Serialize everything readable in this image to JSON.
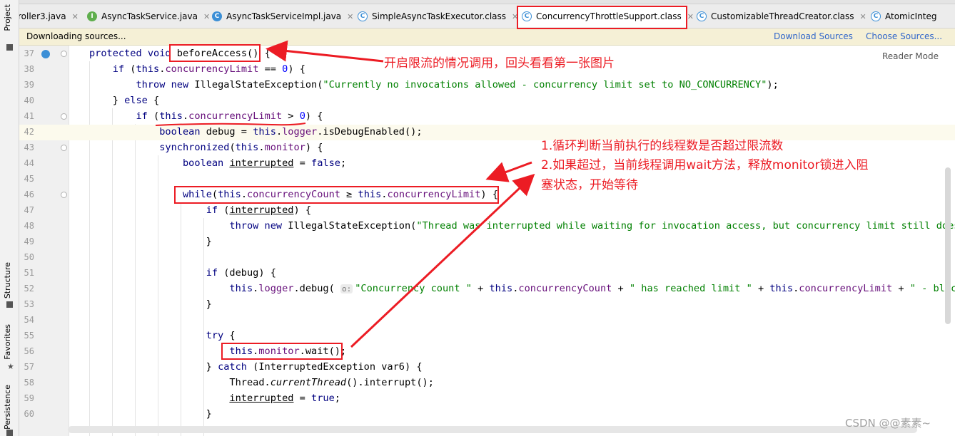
{
  "left_tools": {
    "project": "Project",
    "structure": "Structure",
    "favorites": "Favorites",
    "persistence": "Persistence"
  },
  "tabs": [
    {
      "label": "roller3.java",
      "icon": "class-icon"
    },
    {
      "label": "AsyncTaskService.java",
      "icon": "interface-icon"
    },
    {
      "label": "AsyncTaskServiceImpl.java",
      "icon": "class-icon"
    },
    {
      "label": "SimpleAsyncTaskExecutor.class",
      "icon": "class-file-icon"
    },
    {
      "label": "ConcurrencyThrottleSupport.class",
      "icon": "class-file-icon"
    },
    {
      "label": "CustomizableThreadCreator.class",
      "icon": "class-file-icon"
    },
    {
      "label": "AtomicInteg",
      "icon": "class-file-icon"
    }
  ],
  "infobar": {
    "message": "Downloading sources...",
    "download_sources": "Download Sources",
    "choose_sources": "Choose Sources..."
  },
  "editor": {
    "reader_mode": "Reader Mode",
    "line_numbers": [
      "37",
      "38",
      "39",
      "40",
      "41",
      "42",
      "43",
      "44",
      "45",
      "46",
      "47",
      "48",
      "49",
      "50",
      "51",
      "52",
      "53",
      "54",
      "55",
      "56",
      "57",
      "58",
      "59",
      "60"
    ],
    "hint_o": "o:",
    "tokens": {
      "protected": "protected",
      "void": "void",
      "beforeAccess": "beforeAccess",
      "paren_open_brace": "() {",
      "if": "if",
      "this": "this",
      "concurrencyLimit": "concurrencyLimit",
      "concurrencyCount": "concurrencyCount",
      "logger": "logger",
      "monitor": "monitor",
      "zero": "0",
      "throw": "throw",
      "new": "new",
      "IllegalStateException": "IllegalStateException",
      "else": "else",
      "boolean": "boolean",
      "false": "false",
      "true": "true",
      "synchronized": "synchronized",
      "while": "while",
      "try": "try",
      "catch": "catch",
      "interrupted": "interrupted",
      "currentThread": "currentThread"
    },
    "strings": {
      "no_invocations": "\"Currently no invocations allowed - concurrency limit set to NO_CONCURRENCY\"",
      "thread_interrupted": "\"Thread was interrupted while waiting for invocation access, but concurrency limit still does n",
      "concurrency_count": "\"Concurrency count \"",
      "has_reached_limit": "\" has reached limit \"",
      "blocking": "\" - blockin"
    }
  },
  "annotations": {
    "note1": "开启限流的情况调用，回头看看第一张图片",
    "note2_line1": "1.循环判断当前执行的线程数是否超过限流数",
    "note2_line2": "2.如果超过，当前线程调用wait方法，释放monitor锁进入阻",
    "note2_line3": "塞状态，开始等待",
    "accent_color": "#ec1c24"
  },
  "watermark": "CSDN @@素素~"
}
